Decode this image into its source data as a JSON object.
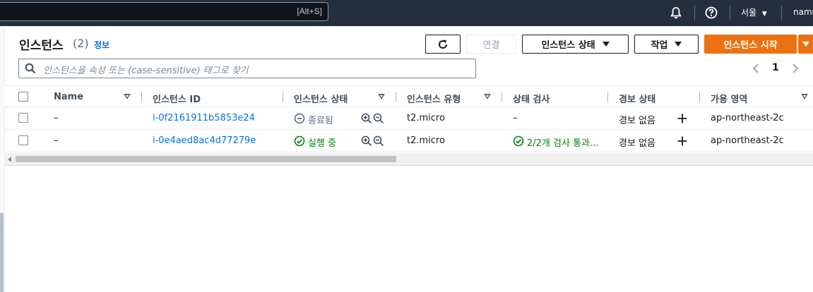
{
  "topnav": {
    "search_shortcut": "[Alt+S]",
    "region": "서울",
    "user": "namu",
    "icons": [
      "bell-icon",
      "help-icon"
    ]
  },
  "header": {
    "title": "인스턴스",
    "count": "(2)",
    "info": "정보",
    "buttons": {
      "refresh_icon": "refresh-icon",
      "connect": "연결",
      "instance_state": "인스턴스 상태",
      "actions": "작업",
      "launch": "인스턴스 시작"
    }
  },
  "filter": {
    "placeholder": "인스턴스을 속성 또는 (case-sensitive) 태그로 찾기"
  },
  "pagination": {
    "page": "1"
  },
  "table": {
    "columns": [
      "Name",
      "인스턴스 ID",
      "인스턴스 상태",
      "인스턴스 유형",
      "상태 검사",
      "경보 상태",
      "가용 영역"
    ],
    "rows": [
      {
        "name": "–",
        "id": "i-0f2161911b5853e24",
        "state": "종료됨",
        "state_icon": "stopped-circle-icon",
        "type": "t2.micro",
        "check": "–",
        "alarm": "경보 없음",
        "az": "ap-northeast-2c"
      },
      {
        "name": "–",
        "id": "i-0e4aed8ac4d77279e",
        "state": "실행 중",
        "state_icon": "running-check-icon",
        "type": "t2.micro",
        "check": "2/2개 검사 통과...",
        "alarm": "경보 없음",
        "az": "ap-northeast-2c"
      }
    ]
  },
  "colors": {
    "nav_bg": "#232f3e",
    "primary": "#ec7211",
    "link": "#0972d3",
    "success": "#037f0c"
  }
}
